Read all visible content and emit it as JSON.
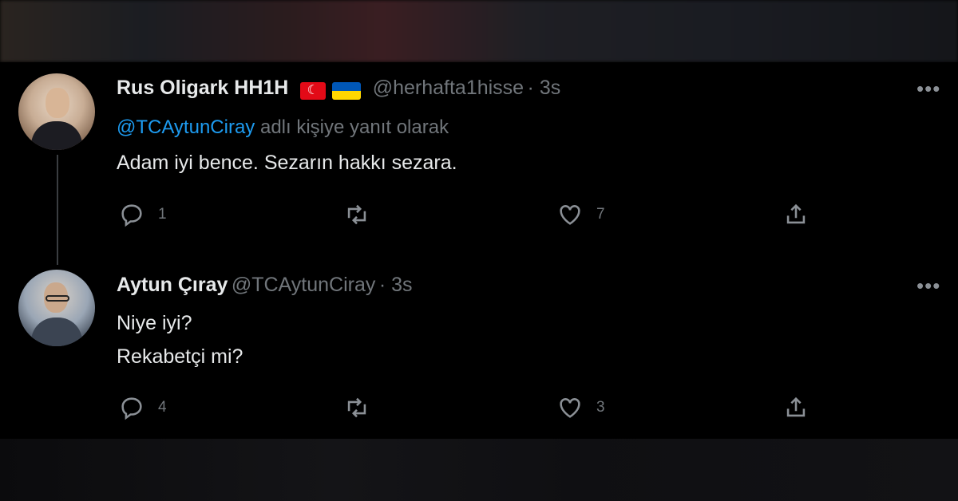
{
  "tweets": [
    {
      "display_name": "Rus Oligark HH1H",
      "handle": "@herhafta1hisse",
      "time": "3s",
      "reply_prefix": "@TCAytunCiray",
      "reply_suffix": "adlı kişiye yanıt olarak",
      "text_lines": [
        "Adam iyi bence. Sezarın hakkı sezara."
      ],
      "reply_count": "1",
      "retweet_count": "",
      "like_count": "7",
      "flags": [
        "turkey-flag",
        "ukraine-flag"
      ],
      "more_label": "•••"
    },
    {
      "display_name": "Aytun Çıray",
      "handle": "@TCAytunCiray",
      "time": "3s",
      "text_lines": [
        "Niye iyi?",
        "Rekabetçi mi?"
      ],
      "reply_count": "4",
      "retweet_count": "",
      "like_count": "3",
      "more_label": "•••"
    }
  ],
  "separator": " · ",
  "colors": {
    "background": "#000000",
    "text": "#e7e9ea",
    "secondary": "#71767b",
    "link": "#1d9bf0",
    "thread_line": "#3a3d41"
  },
  "icons": [
    "reply-icon",
    "retweet-icon",
    "like-icon",
    "share-icon",
    "more-icon"
  ]
}
